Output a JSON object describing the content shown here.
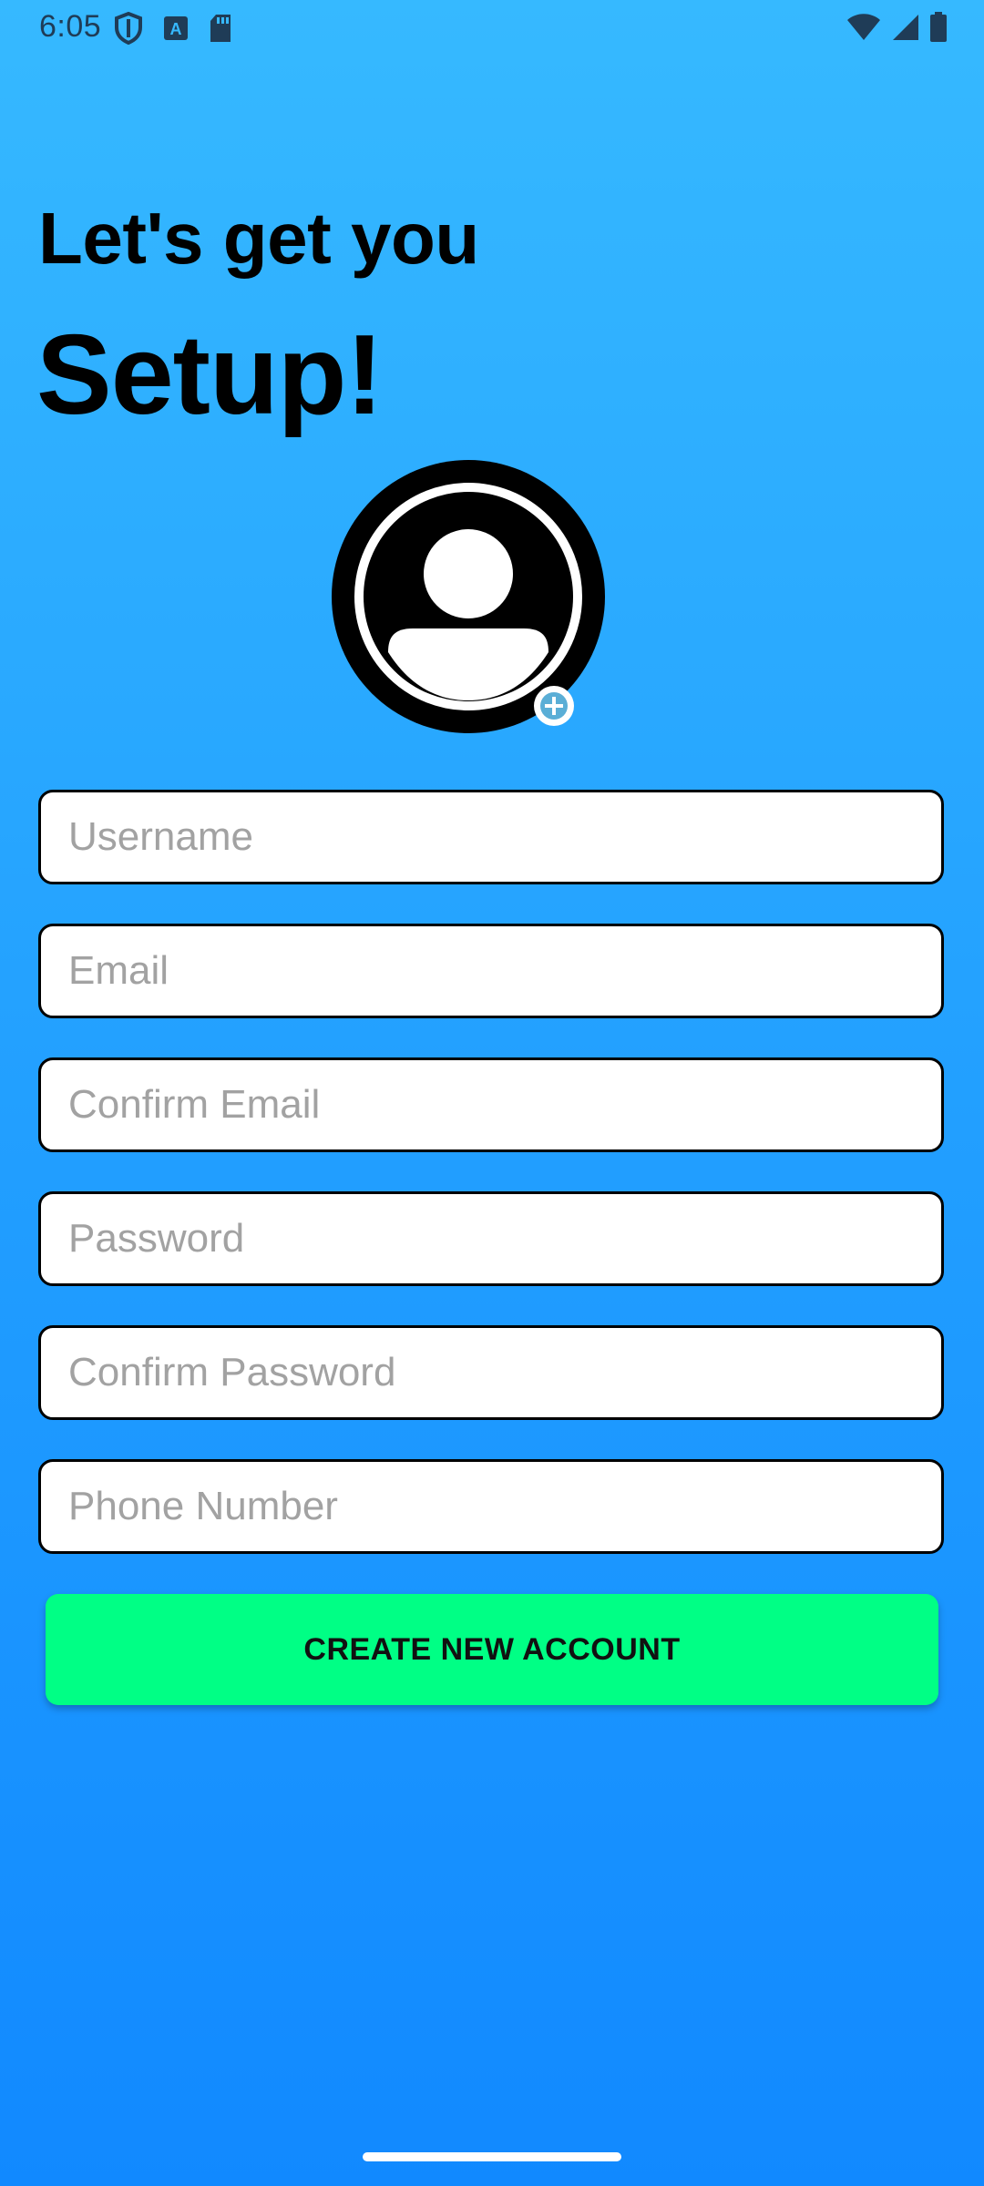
{
  "status_bar": {
    "time": "6:05",
    "left_icons": [
      "shield-icon",
      "font-a-icon",
      "sd-card-icon"
    ],
    "right_icons": [
      "wifi-icon",
      "cellular-signal-icon",
      "battery-icon"
    ]
  },
  "heading": {
    "line1": "Let's get you",
    "line2": "Setup!"
  },
  "avatar": {
    "icon": "profile-avatar-icon",
    "add_icon": "add-photo-icon"
  },
  "form": {
    "username": {
      "value": "",
      "placeholder": "Username"
    },
    "email": {
      "value": "",
      "placeholder": "Email"
    },
    "confirm_email": {
      "value": "",
      "placeholder": "Confirm Email"
    },
    "password": {
      "value": "",
      "placeholder": "Password"
    },
    "confirm_password": {
      "value": "",
      "placeholder": "Confirm Password"
    },
    "phone_number": {
      "value": "",
      "placeholder": "Phone Number"
    }
  },
  "actions": {
    "create_account_label": "CREATE NEW ACCOUNT"
  },
  "colors": {
    "background_top": "#36b9ff",
    "background_bottom": "#1189ff",
    "button": "#00ff85",
    "field_border": "#000000"
  }
}
